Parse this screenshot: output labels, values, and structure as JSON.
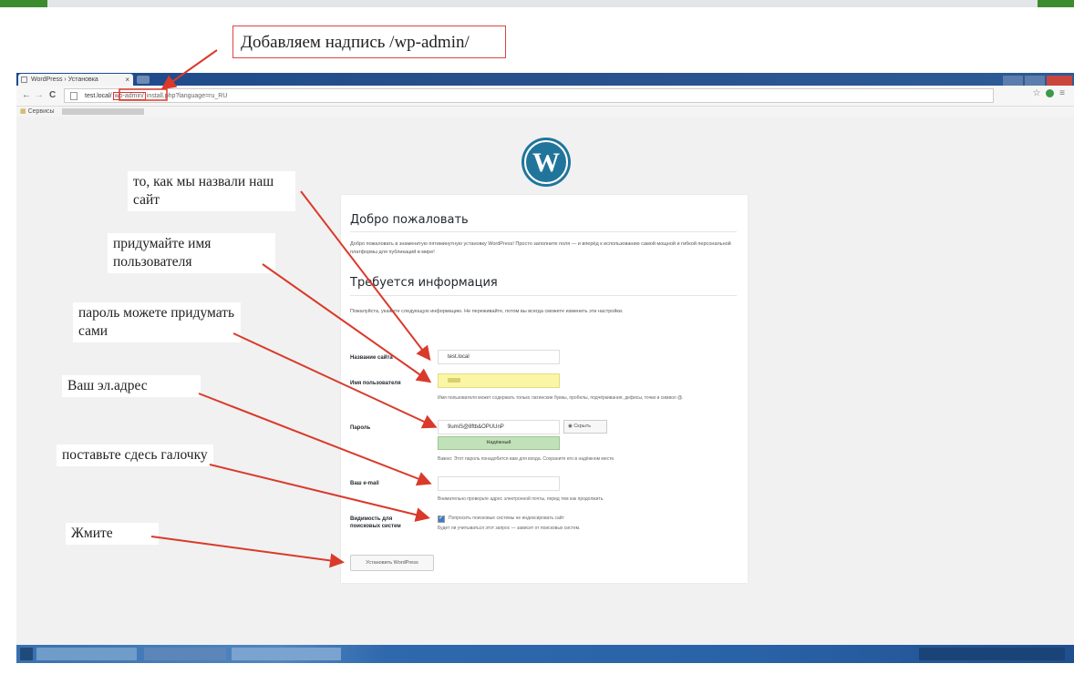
{
  "annotation_top": "Добавляем надпись /wp-admin/",
  "browser": {
    "tab_title": "WordPress › Установка",
    "tab_close": "×",
    "url_host": "test.local/",
    "url_highlight": "wp-admin/",
    "url_rest": "install.php?language=ru_RU",
    "back_icon": "←",
    "forward_icon": "→",
    "reload_icon": "C",
    "bookmarks_label": "Сервисы",
    "menu_icon": "≡",
    "star_icon": "☆"
  },
  "wp": {
    "welcome_title": "Добро пожаловать",
    "welcome_desc": "Добро пожаловать в знаменитую пятиминутную установку WordPress! Просто заполните поля — и вперёд к использованию самой мощной и гибкой персональной платформы для публикаций в мире!",
    "info_title": "Требуется информация",
    "info_desc": "Пожалуйста, укажите следующую информацию. Не переживайте, потом вы всегда сможете изменить эти настройки.",
    "site_name_label": "Название сайта",
    "site_name_value": "test.local",
    "username_label": "Имя пользователя",
    "username_hint": "Имя пользователя может содержать только латинские буквы, пробелы, подчёркивания, дефисы, точки и символ @.",
    "password_label": "Пароль",
    "password_value": "9umiS@8ftb&OPUUnP",
    "hide_button": "Скрыть",
    "strength_label": "Надёжный",
    "password_hint": "Важно: Этот пароль понадобится вам для входа. Сохраните его в надёжном месте.",
    "email_label": "Ваш e-mail",
    "email_hint": "Внимательно проверьте адрес электронной почты, перед тем как продолжить.",
    "privacy_label": "Видимость для поисковых систем",
    "privacy_text": "Попросить поисковые системы не индексировать сайт",
    "privacy_hint": "Будет ли учитываться этот запрос — зависит от поисковых систем.",
    "install_button": "Установить WordPress"
  },
  "notes": {
    "site": "то, как мы назвали наш сайт",
    "user": "придумайте имя пользователя",
    "pass": "пароль можете придумать сами",
    "email": "Ваш эл.адрес",
    "check": "поставьте сдесь галочку",
    "press": "Жмите"
  },
  "colors": {
    "annotation_red": "#d93a2b",
    "wp_blue": "#21759b",
    "strength_green": "#c1e1b9",
    "username_yellow": "#fbf6a5"
  },
  "icons": [
    "wordpress-logo-icon",
    "back-icon",
    "forward-icon",
    "reload-icon",
    "page-icon",
    "star-icon",
    "menu-icon",
    "checkbox-icon"
  ]
}
